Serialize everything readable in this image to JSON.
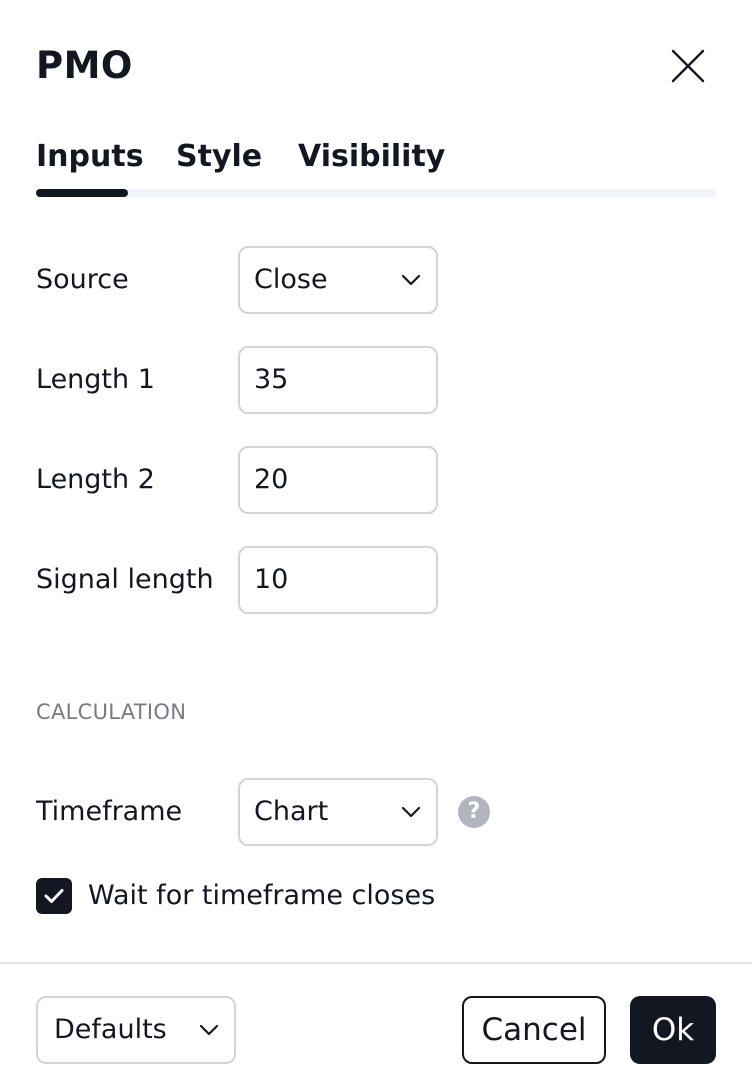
{
  "dialog": {
    "title": "PMO"
  },
  "tabs": [
    {
      "label": "Inputs",
      "active": true
    },
    {
      "label": "Style",
      "active": false
    },
    {
      "label": "Visibility",
      "active": false
    }
  ],
  "inputs": {
    "source": {
      "label": "Source",
      "value": "Close"
    },
    "length1": {
      "label": "Length 1",
      "value": "35"
    },
    "length2": {
      "label": "Length 2",
      "value": "20"
    },
    "signal_length": {
      "label": "Signal length",
      "value": "10"
    }
  },
  "calculation": {
    "section_title": "CALCULATION",
    "timeframe": {
      "label": "Timeframe",
      "value": "Chart"
    },
    "help_icon": "question-mark-icon",
    "wait_for_closes": {
      "label": "Wait for timeframe closes",
      "checked": true
    }
  },
  "footer": {
    "defaults_label": "Defaults",
    "cancel_label": "Cancel",
    "ok_label": "Ok"
  },
  "colors": {
    "text": "#131722",
    "muted": "#787b86",
    "border": "#d1d4dc",
    "help_icon_bg": "#b2b5be",
    "primary_button": "#131722"
  }
}
